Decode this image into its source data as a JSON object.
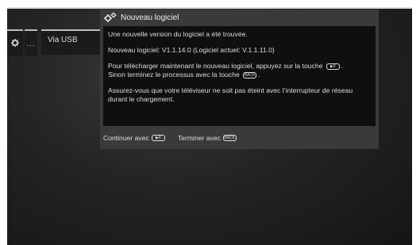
{
  "menu": {
    "more_label": "...",
    "usb_label": "Via USB"
  },
  "dialog": {
    "title": "Nouveau logiciel",
    "line1": "Une nouvelle version du logiciel a été trouvée.",
    "version_line": "Nouveau logiciel:  V1.1.14.0   (Logiciel actuel:  V.1.1.11.0)",
    "download_line1": "Pour télécharger maintenant le nouveau logiciel, appuyez sur la touche",
    "download_line2": "Sinon terminez le processus avec la touche",
    "period": ".",
    "warning": "Assurez-vous que votre téléviseur ne soit pas éteint avec l’interrupteur de réseau durant le chargement."
  },
  "footer": {
    "continue_label": "Continuer avec",
    "finish_label": "Terminer avec"
  },
  "keys": {
    "play_key": "▶II",
    "back_key": "BACK"
  },
  "colors": {
    "dialog_bg": "#3a3a3a",
    "body_bg": "#0f0f0f",
    "text": "#dedede"
  }
}
